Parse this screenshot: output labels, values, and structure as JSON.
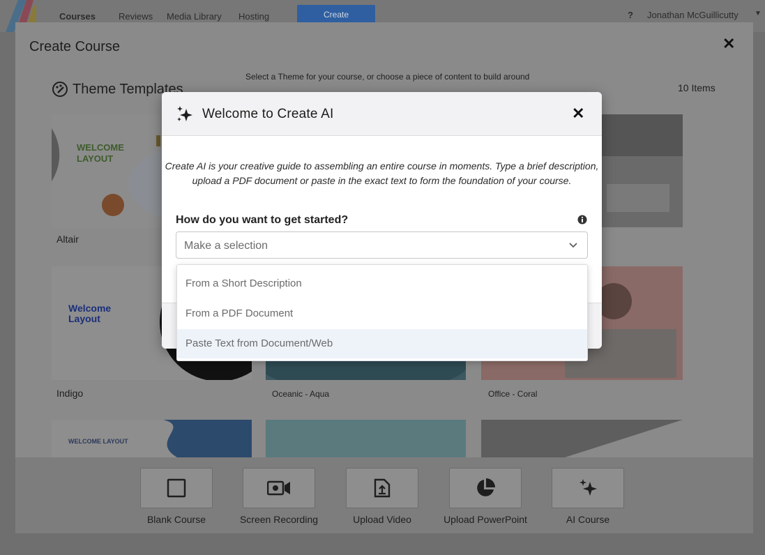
{
  "nav": {
    "items": [
      "Courses",
      "Reviews",
      "Media Library",
      "Hosting"
    ],
    "create_label": "Create",
    "help_label": "?",
    "user_name": "Jonathan McGuillicutty"
  },
  "panel": {
    "title": "Create Course",
    "subtitle": "Select a Theme for your course, or choose a piece of content to build around",
    "section_title": "Theme Templates",
    "items_count": "10 Items",
    "cards": [
      {
        "name": "Altair",
        "preview_text": "WELCOME LAYOUT"
      },
      {
        "name": "Indigo",
        "preview_text": "Welcome Layout"
      },
      {
        "name": "Oceanic - Aqua"
      },
      {
        "name": "Office - Coral"
      },
      {
        "name": "",
        "preview_text": "WELCOME LAYOUT"
      }
    ]
  },
  "bottom_tiles": [
    {
      "label": "Blank Course",
      "icon": "square-icon"
    },
    {
      "label": "Screen Recording",
      "icon": "camera-icon"
    },
    {
      "label": "Upload Video",
      "icon": "upload-icon"
    },
    {
      "label": "Upload PowerPoint",
      "icon": "pie-chart-icon"
    },
    {
      "label": "AI Course",
      "icon": "sparkle-icon"
    }
  ],
  "modal": {
    "title": "Welcome to Create AI",
    "intro_line1": "Create AI is your creative guide to assembling an entire course in moments. Type a brief description,",
    "intro_line2": "upload a PDF document or paste in the exact text to form the foundation of your course.",
    "question": "How do you want to get started?",
    "select_placeholder": "Make a selection",
    "options": [
      "From a Short Description",
      "From a PDF Document",
      "Paste Text from Document/Web"
    ]
  },
  "colors": {
    "overlay": "#6f6f6f",
    "modal_header_bg": "#f2f2f4",
    "option_hover_bg": "#eef3fa",
    "nav_create_bg": "#2f5fa0"
  }
}
